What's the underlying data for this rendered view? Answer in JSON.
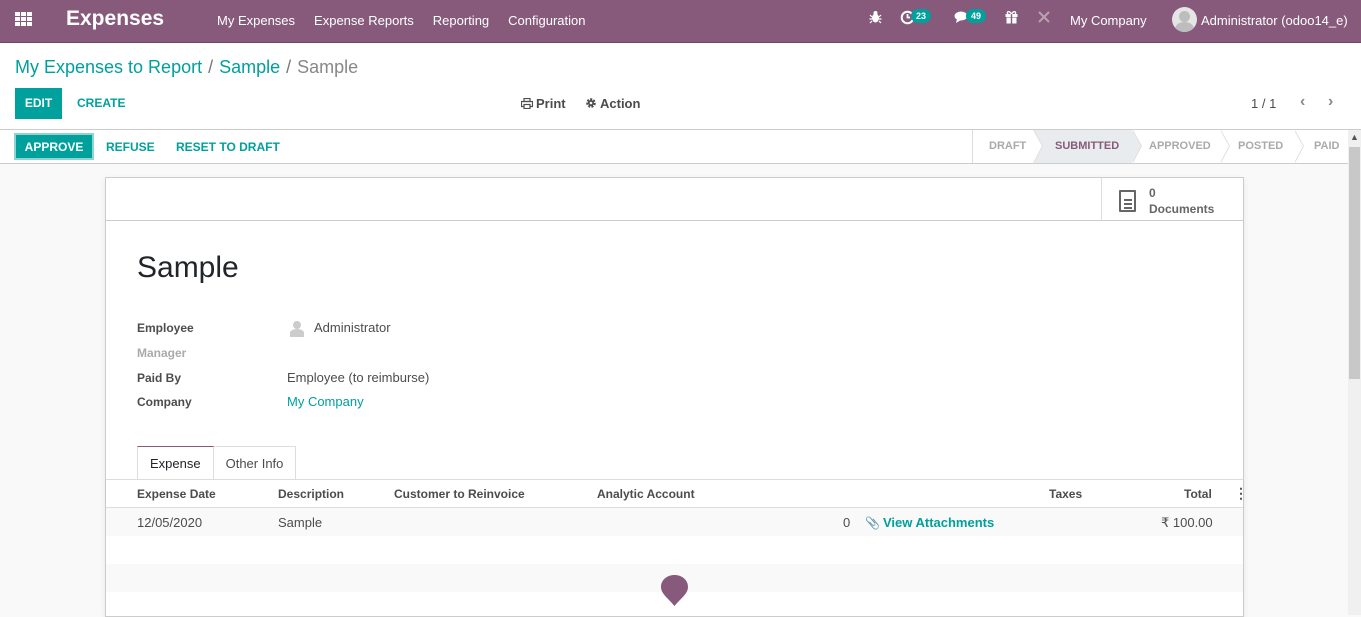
{
  "navbar": {
    "app_name": "Expenses",
    "menu": [
      "My Expenses",
      "Expense Reports",
      "Reporting",
      "Configuration"
    ],
    "activity_count": "23",
    "messages_count": "49",
    "company": "My Company",
    "user": "Administrator (odoo14_e)",
    "brand_color": "#875a7b"
  },
  "breadcrumb": {
    "items": [
      "My Expenses to Report",
      "Sample"
    ],
    "current": "Sample",
    "separator": "/"
  },
  "toolbar": {
    "edit_label": "EDIT",
    "create_label": "CREATE",
    "print_label": "Print",
    "action_label": "Action",
    "pager": "1 / 1"
  },
  "statusbar": {
    "approve_label": "APPROVE",
    "refuse_label": "REFUSE",
    "reset_label": "RESET TO DRAFT",
    "stages": [
      {
        "label": "DRAFT",
        "active": false
      },
      {
        "label": "SUBMITTED",
        "active": true
      },
      {
        "label": "APPROVED",
        "active": false
      },
      {
        "label": "POSTED",
        "active": false
      },
      {
        "label": "PAID",
        "active": false
      }
    ]
  },
  "smart_button": {
    "value": "0",
    "label": "Documents"
  },
  "record": {
    "title": "Sample",
    "fields": [
      {
        "label": "Employee",
        "value": "Administrator"
      },
      {
        "label": "Manager",
        "value": ""
      },
      {
        "label": "Paid By",
        "value": "Employee (to reimburse)"
      },
      {
        "label": "Company",
        "value": "My Company"
      }
    ]
  },
  "tabs": [
    "Expense",
    "Other Info"
  ],
  "expense_list": {
    "columns": [
      "Expense Date",
      "Description",
      "Customer to Reinvoice",
      "Analytic Account",
      "Taxes",
      "Total"
    ],
    "rows": [
      {
        "date": "12/05/2020",
        "description": "Sample",
        "customer": "",
        "analytic": "",
        "attachments_count": "0",
        "attachments_label": "View Attachments",
        "taxes": "",
        "total": "₹ 100.00"
      }
    ]
  }
}
